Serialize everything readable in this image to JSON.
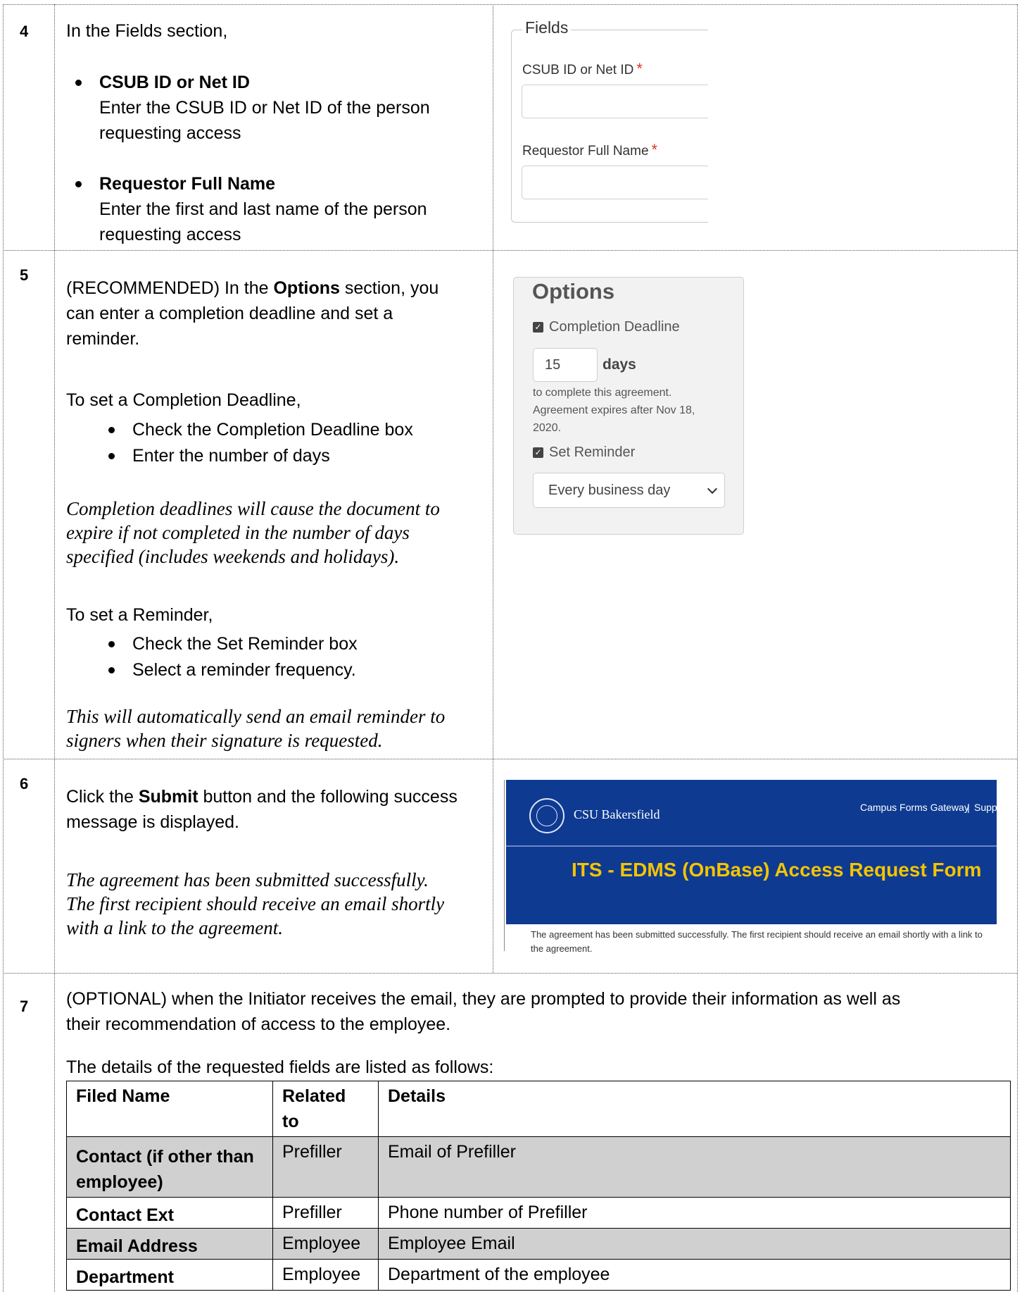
{
  "step4": {
    "number": "4",
    "intro": "In the Fields section,",
    "bullets": [
      {
        "title": "CSUB ID or Net ID",
        "desc_line1": "Enter the CSUB ID or Net ID of the person",
        "desc_line2": "requesting access"
      },
      {
        "title": "Requestor Full Name",
        "desc_line1": "Enter the first and last name of the person",
        "desc_line2": "requesting access"
      }
    ],
    "panel": {
      "legend": "Fields",
      "fields": [
        {
          "label": "CSUB ID or Net ID",
          "required_mark": "*",
          "value": ""
        },
        {
          "label": "Requestor Full Name",
          "required_mark": "*",
          "value": ""
        }
      ]
    }
  },
  "step5": {
    "number": "5",
    "intro_prefix": "(RECOMMENDED) In the ",
    "intro_bold": "Options",
    "intro_suffix": " section, you",
    "intro_line2": "can enter a completion deadline and set a",
    "intro_line3": "reminder.",
    "deadline_heading": "To set a Completion Deadline,",
    "deadline_bullets": [
      "Check the Completion Deadline box",
      "Enter the number of days"
    ],
    "deadline_note": [
      "Completion deadlines will cause the document to",
      "expire if not completed in the number of days",
      "specified (includes weekends and holidays)."
    ],
    "reminder_heading": "To set a Reminder,",
    "reminder_bullets": [
      "Check the Set Reminder box",
      "Select a reminder frequency."
    ],
    "reminder_note": [
      "This will automatically send an email reminder to",
      "signers when their signature is requested."
    ],
    "panel": {
      "title": "Options",
      "deadline_checkbox": {
        "label": "Completion Deadline",
        "checked": true
      },
      "days_value": "15",
      "days_label": "days",
      "expire_text": [
        "to complete this agreement.",
        "Agreement expires after Nov 18,",
        "2020."
      ],
      "reminder_checkbox": {
        "label": "Set Reminder",
        "checked": true
      },
      "reminder_selected": "Every business day"
    }
  },
  "step6": {
    "number": "6",
    "text_prefix": "Click the ",
    "text_bold": "Submit",
    "text_suffix": " button and the following success",
    "text_line2": "message is displayed.",
    "note": [
      "The agreement has been submitted successfully.",
      "The first recipient should receive an email shortly",
      "with a link to the agreement."
    ],
    "screenshot": {
      "brand": "CSU Bakersfield",
      "nav_link_1": "Campus Forms Gateway",
      "nav_sep": "|",
      "nav_link_2": "Support",
      "form_title": "ITS - EDMS (OnBase) Access Request Form",
      "message": "The agreement has been submitted successfully. The first recipient should receive an email shortly with a link to the agreement.",
      "colors": {
        "header": "#0e3a92",
        "title": "#f5c400"
      }
    }
  },
  "step7": {
    "number": "7",
    "intro_line1": "(OPTIONAL) when the Initiator receives the email, they are prompted to provide their information as well as",
    "intro_line2": "their recommendation of access to the employee.",
    "table_caption": "The details of the requested fields are listed as follows:",
    "headers": {
      "col1": "Filed Name",
      "col2_line1": "Related",
      "col2_line2": "to",
      "col3": "Details"
    },
    "rows": [
      {
        "field_line1": "Contact (if other than",
        "field_line2": "employee)",
        "related": "Prefiller",
        "details": "Email of Prefiller"
      },
      {
        "field": "Contact Ext",
        "related": "Prefiller",
        "details": "Phone number of Prefiller"
      },
      {
        "field": "Email Address",
        "related": "Employee",
        "details": "Employee Email"
      },
      {
        "field": "Department",
        "related": "Employee",
        "details": "Department of the employee"
      }
    ]
  }
}
